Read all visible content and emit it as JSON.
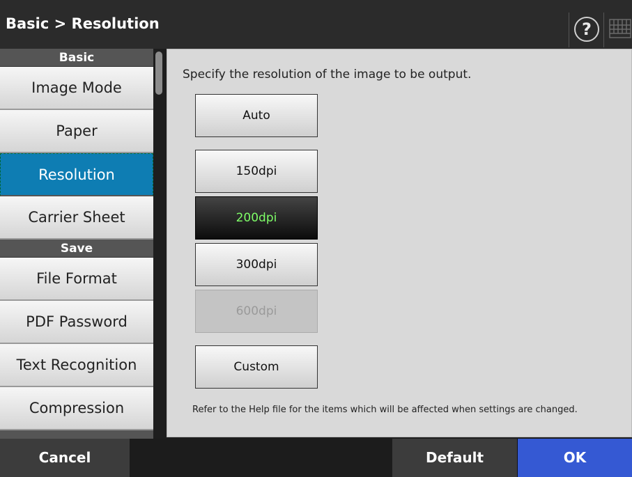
{
  "header": {
    "title": "Basic > Resolution",
    "help_label": "?"
  },
  "sidebar": {
    "sections": [
      {
        "label": "Basic"
      },
      {
        "label": "Save"
      }
    ],
    "items": [
      {
        "label": "Image Mode"
      },
      {
        "label": "Paper"
      },
      {
        "label": "Resolution"
      },
      {
        "label": "Carrier Sheet"
      },
      {
        "label": "File Format"
      },
      {
        "label": "PDF Password"
      },
      {
        "label": "Text Recognition"
      },
      {
        "label": "Compression"
      }
    ],
    "selected_item": "Resolution"
  },
  "main": {
    "instruction": "Specify the resolution of the image to be output.",
    "options": [
      {
        "label": "Auto",
        "state": "normal"
      },
      {
        "label": "150dpi",
        "state": "normal"
      },
      {
        "label": "200dpi",
        "state": "selected"
      },
      {
        "label": "300dpi",
        "state": "normal"
      },
      {
        "label": "600dpi",
        "state": "disabled"
      },
      {
        "label": "Custom",
        "state": "normal"
      }
    ],
    "note": "Refer to the Help file for the items which will be affected when settings are changed."
  },
  "footer": {
    "cancel_label": "Cancel",
    "default_label": "Default",
    "ok_label": "OK"
  },
  "colors": {
    "selected_nav": "#0e7db3",
    "selected_option_text": "#7fff68",
    "ok_button": "#3559d3"
  }
}
